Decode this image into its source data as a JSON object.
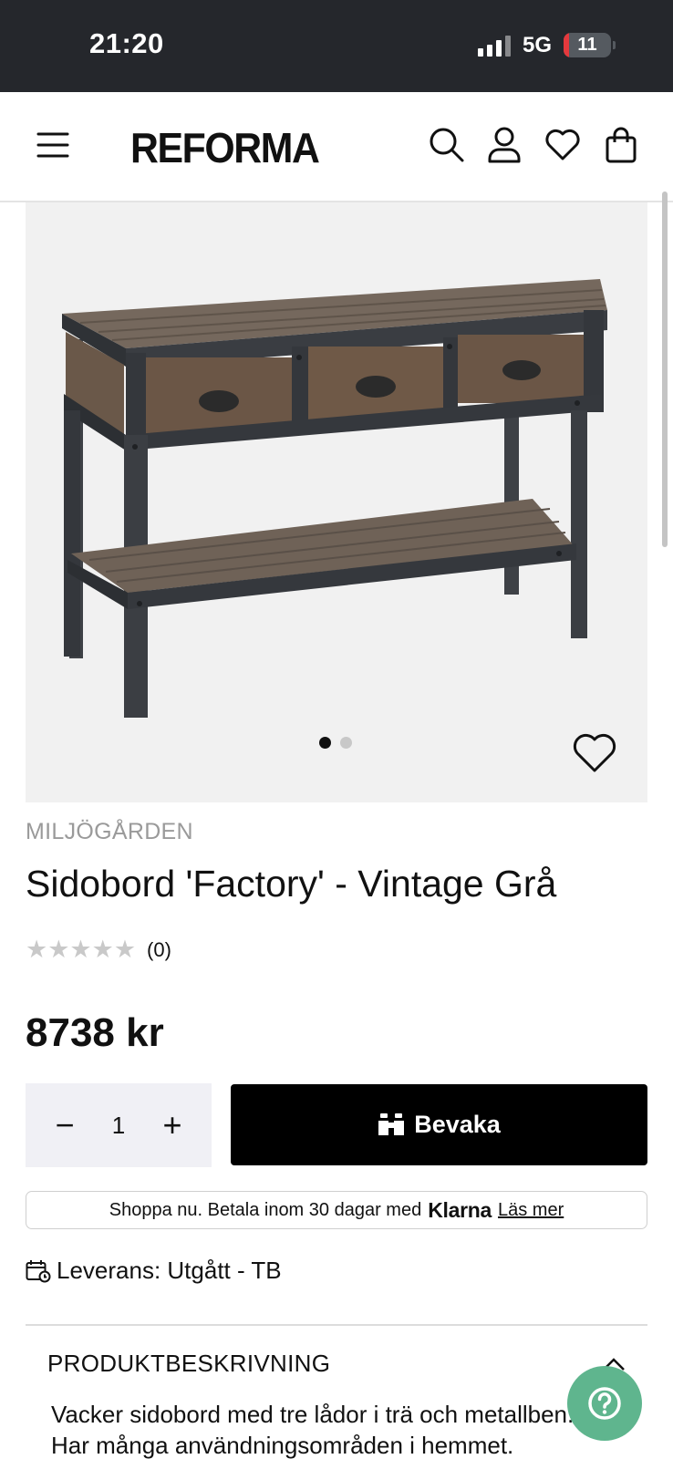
{
  "status_bar": {
    "time": "21:20",
    "network": "5G",
    "battery_level": "11",
    "battery_fraction": 0.11,
    "battery_color": "#e5393d"
  },
  "header": {
    "logo": "REFORMA",
    "icons": [
      "menu-icon",
      "search-icon",
      "account-icon",
      "heart-icon",
      "bag-icon"
    ]
  },
  "gallery": {
    "image_count": 2,
    "active_index": 0
  },
  "product": {
    "brand": "MILJÖGÅRDEN",
    "title": "Sidobord 'Factory' - Vintage Grå",
    "rating_stars": "★★★★★",
    "rating_value": 0,
    "review_count": "(0)",
    "price": "8738 kr"
  },
  "purchase": {
    "minus": "−",
    "quantity": "1",
    "plus": "+",
    "watch_label": "Bevaka"
  },
  "klarna": {
    "text": "Shoppa nu. Betala inom 30 dagar med",
    "logo": "Klarna",
    "link": "Läs mer"
  },
  "delivery": {
    "label": "Leverans: Utgått - TB"
  },
  "description": {
    "heading": "PRODUKTBESKRIVNING",
    "lines": [
      "Vacker sidobord med tre lådor i trä och metallben.",
      "Har många användningsområden i hemmet."
    ]
  },
  "colors": {
    "status_bar_bg": "#25272c",
    "button_bg": "#000000",
    "help_fab": "#5fb58e",
    "muted_text": "#9a9a9a"
  }
}
